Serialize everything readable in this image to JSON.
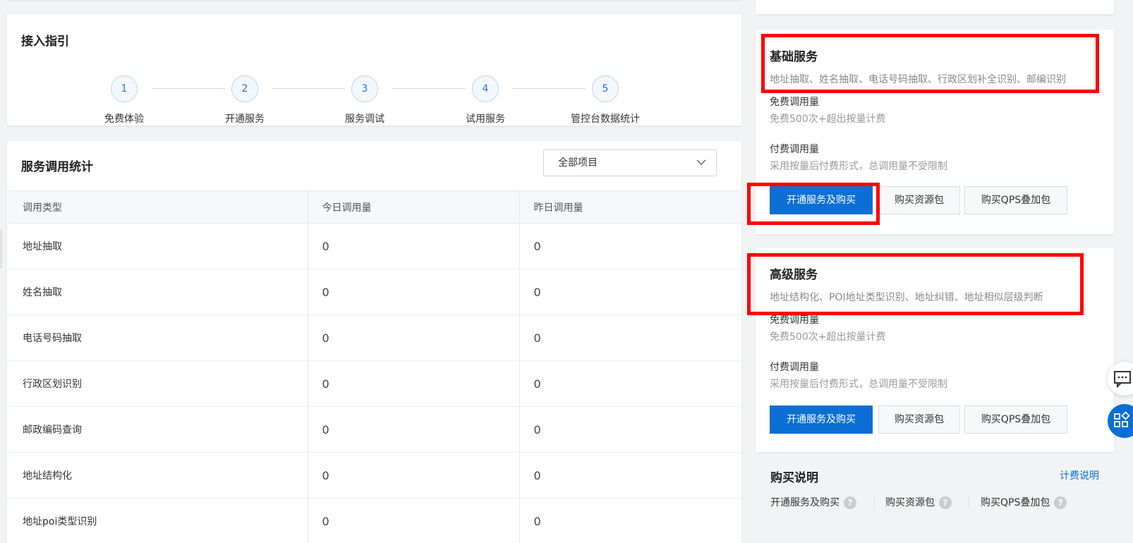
{
  "guide": {
    "title": "接入指引",
    "steps": [
      {
        "num": "1",
        "label": "免费体验"
      },
      {
        "num": "2",
        "label": "开通服务"
      },
      {
        "num": "3",
        "label": "服务调试"
      },
      {
        "num": "4",
        "label": "试用服务"
      },
      {
        "num": "5",
        "label": "管控台数据统计"
      }
    ]
  },
  "stats": {
    "title": "服务调用统计",
    "project_select": "全部项目",
    "columns": [
      "调用类型",
      "今日调用量",
      "昨日调用量"
    ],
    "rows": [
      {
        "type": "地址抽取",
        "today": "0",
        "yesterday": "0"
      },
      {
        "type": "姓名抽取",
        "today": "0",
        "yesterday": "0"
      },
      {
        "type": "电话号码抽取",
        "today": "0",
        "yesterday": "0"
      },
      {
        "type": "行政区划识别",
        "today": "0",
        "yesterday": "0"
      },
      {
        "type": "邮政编码查询",
        "today": "0",
        "yesterday": "0"
      },
      {
        "type": "地址结构化",
        "today": "0",
        "yesterday": "0"
      },
      {
        "type": "地址poi类型识别",
        "today": "0",
        "yesterday": "0"
      }
    ]
  },
  "basic": {
    "title": "基础服务",
    "desc": "地址抽取、姓名抽取、电话号码抽取、行政区划补全识别、邮编识别",
    "free_label": "免费调用量",
    "free_value": "免费500次+超出按量计费",
    "paid_label": "付费调用量",
    "paid_value": "采用按量后付费形式，总调用量不受限制",
    "buttons": [
      "开通服务及购买",
      "购买资源包",
      "购买QPS叠加包"
    ]
  },
  "advanced": {
    "title": "高级服务",
    "desc": "地址结构化、POI地址类型识别、地址纠错、地址相似层级判断",
    "free_label": "免费调用量",
    "free_value": "免费500次+超出按量计费",
    "paid_label": "付费调用量",
    "paid_value": "采用按量后付费形式，总调用量不受限制",
    "buttons": [
      "开通服务及购买",
      "购买资源包",
      "购买QPS叠加包"
    ]
  },
  "note": {
    "title": "购买说明",
    "link": "计费说明",
    "items": [
      "开通服务及购买",
      "购买资源包",
      "购买QPS叠加包"
    ]
  },
  "colors": {
    "primary": "#0b6fd3",
    "highlight": "#ff0000"
  },
  "icons": {
    "help": "?",
    "chat": "chat-icon",
    "apps": "apps-icon",
    "dropdown": "chevron-down-icon"
  }
}
